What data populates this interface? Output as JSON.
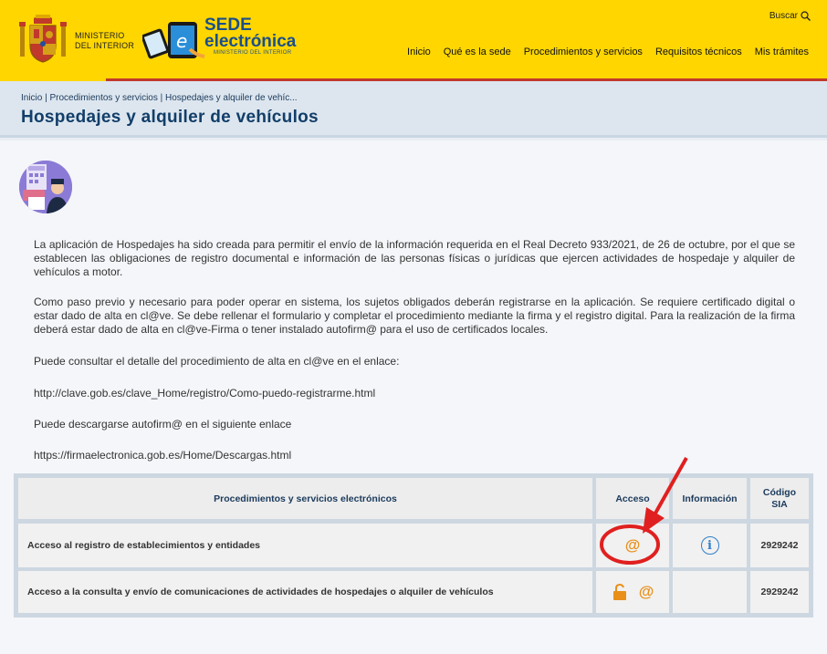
{
  "header": {
    "ministry_line1": "MINISTERIO",
    "ministry_line2": "DEL INTERIOR",
    "sede_line1": "SEDE",
    "sede_line2": "electrónica",
    "sede_sub": "MINISTERIO DEL INTERIOR",
    "search_label": "Buscar",
    "nav": [
      "Inicio",
      "Qué es la sede",
      "Procedimientos y servicios",
      "Requisitos técnicos",
      "Mis trámites"
    ]
  },
  "breadcrumb": "Inicio | Procedimientos y servicios | Hospedajes y alquiler de vehíc...",
  "page_title": "Hospedajes y alquiler de vehículos",
  "content": {
    "p1": "La aplicación de Hospedajes ha sido creada para permitir el envío de la información requerida en el Real Decreto 933/2021, de 26 de octubre, por el que se establecen las obligaciones de registro documental e información de las personas físicas o jurídicas que ejercen actividades de hospedaje y alquiler de vehículos a motor.",
    "p2": "Como paso previo y necesario para poder operar en sistema, los sujetos obligados deberán registrarse en la aplicación. Se requiere certificado digital o estar dado de alta en cl@ve. Se debe rellenar el formulario y completar el procedimiento mediante la firma y el registro digital. Para la realización de la firma deberá estar dado de alta en cl@ve-Firma o tener instalado autofirm@ para el uso de certificados locales.",
    "p3": "Puede consultar el detalle del procedimiento de alta en cl@ve en el enlace:",
    "p4": "http://clave.gob.es/clave_Home/registro/Como-puedo-registrarme.html",
    "p5": "Puede descargarse autofirm@ en el siguiente enlace",
    "p6": "https://firmaelectronica.gob.es/Home/Descargas.html"
  },
  "table": {
    "headers": {
      "procedures": "Procedimientos y servicios electrónicos",
      "access": "Acceso",
      "info": "Información",
      "code": "Código SIA"
    },
    "rows": [
      {
        "name": "Acceso al registro de establecimientos y entidades",
        "access_icon": "@",
        "info_icon": "i",
        "code": "2929242"
      },
      {
        "name": "Acceso a la consulta y envío de comunicaciones de actividades de hospedajes o alquiler de vehículos",
        "access_icon": "@",
        "code": "2929242"
      }
    ]
  }
}
